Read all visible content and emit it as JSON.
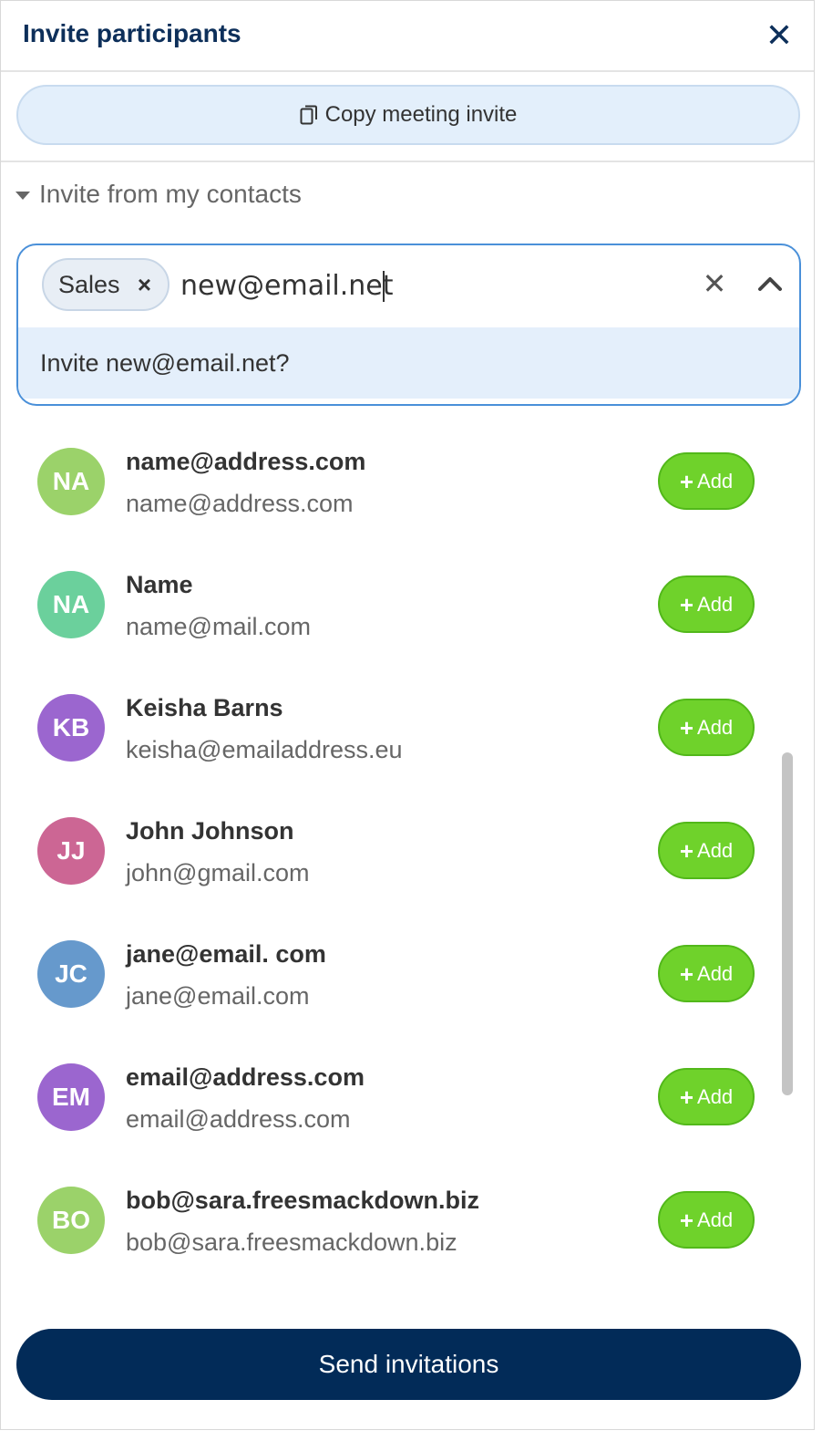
{
  "header": {
    "title": "Invite participants",
    "close_icon": "close-icon"
  },
  "copy_button": {
    "label": "Copy meeting invite",
    "icon": "copy-icon"
  },
  "contacts_section": {
    "toggle_label": "Invite from my contacts",
    "icon": "caret-down-icon"
  },
  "combo": {
    "chip_label": "Sales",
    "input_value": "new@email.net",
    "suggestion": "Invite new@email.net?"
  },
  "contacts": [
    {
      "initials": "NA",
      "name": "name@address.com",
      "email": "name@address.com",
      "color": "#9bd26a"
    },
    {
      "initials": "NA",
      "name": "Name",
      "email": "name@mail.com",
      "color": "#6bd09c"
    },
    {
      "initials": "KB",
      "name": "Keisha Barns",
      "email": "keisha@emailaddress.eu",
      "color": "#9b66cf"
    },
    {
      "initials": "JJ",
      "name": "John Johnson",
      "email": "john@gmail.com",
      "color": "#cc6694"
    },
    {
      "initials": "JC",
      "name": "jane@email. com",
      "email": "jane@email.com",
      "color": "#6699cc"
    },
    {
      "initials": "EM",
      "name": "email@address.com",
      "email": "email@address.com",
      "color": "#9b66cf"
    },
    {
      "initials": "BO",
      "name": "bob@sara.freesmackdown.biz",
      "email": "bob@sara.freesmackdown.biz",
      "color": "#9bd26a"
    }
  ],
  "add_label": "Add",
  "send_button": {
    "label": "Send invitations"
  },
  "colors": {
    "accent": "#022b58",
    "add_green": "#6fd22b",
    "focus_blue": "#4a90d9"
  }
}
